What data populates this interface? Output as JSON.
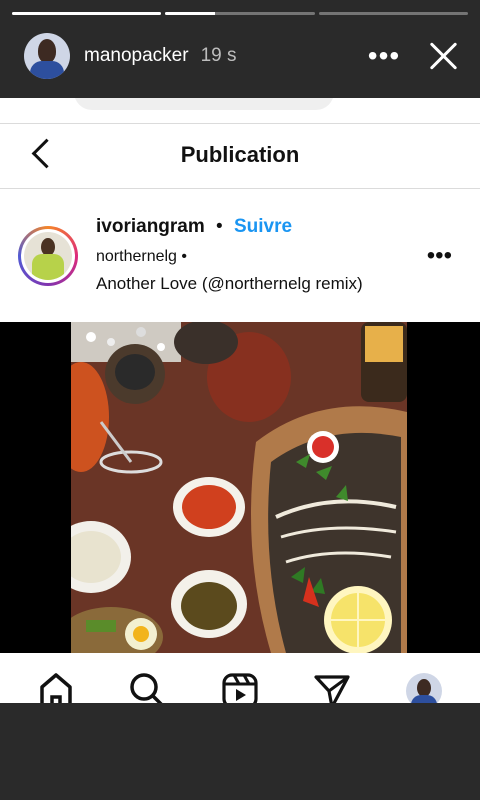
{
  "story": {
    "username": "manopacker",
    "time": "19 s",
    "progress": [
      1.0,
      0.33,
      0.0
    ],
    "more_icon": "more-horizontal-icon",
    "close_icon": "close-icon"
  },
  "post_view": {
    "title": "Publication",
    "back_icon": "chevron-left-icon"
  },
  "post": {
    "username": "ivoriangram",
    "separator": "•",
    "follow_label": "Suivre",
    "audio_artist": "northernelg •",
    "audio_track": "Another Love (@northernelg remix)",
    "more_label": "•••"
  },
  "story_header": {
    "more_label": "•••"
  },
  "bottom_nav": {
    "items": [
      "home-icon",
      "search-icon",
      "reels-icon",
      "direct-message-icon",
      "profile-avatar"
    ]
  },
  "colors": {
    "follow": "#1a95f2",
    "story_bg": "#2a2a2a"
  }
}
